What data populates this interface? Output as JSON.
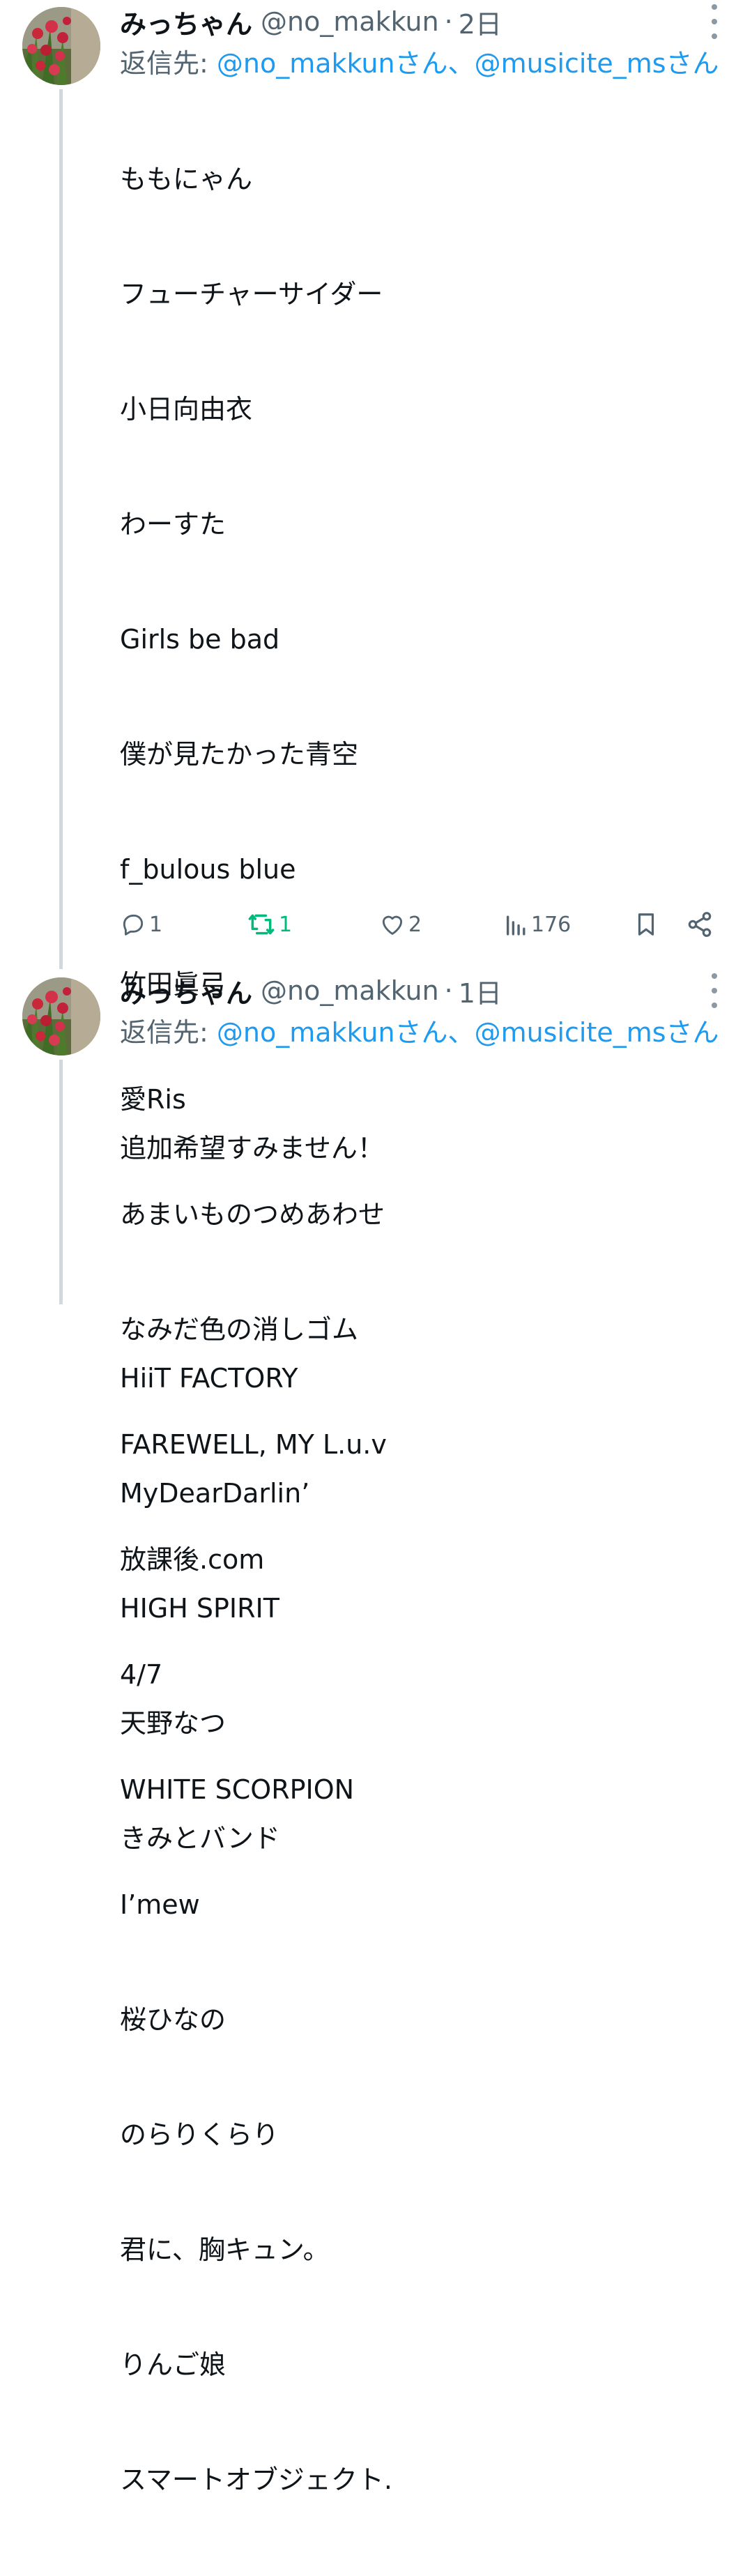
{
  "tweets": [
    {
      "display_name": "みっちゃん",
      "handle": "@no_makkun",
      "separator": "·",
      "time": "2日",
      "reply_prefix": "返信先: ",
      "reply_mention_1": "@no_makkunさん",
      "reply_sep": "、",
      "reply_mention_2": "@musicite_msさん",
      "lines": [
        "ももにゃん",
        "フューチャーサイダー",
        "小日向由衣",
        "わーすた",
        "Girls be bad",
        "僕が見たかった青空",
        "f_bulous blue",
        "竹田眞弓",
        "愛Ris",
        "あまいものつめあわせ",
        "なみだ色の消しゴム",
        "FAREWELL, MY L.u.v",
        "放課後.com",
        "4/7",
        "WHITE SCORPION",
        "I’mew",
        "桜ひなの",
        "のらりくらり",
        "君に、胸キュン。",
        "りんご娘",
        "スマートオブジェクト."
      ],
      "stats": {
        "replies": "1",
        "retweets": "1",
        "likes": "2",
        "views": "176"
      }
    },
    {
      "display_name": "みっちゃん",
      "handle": "@no_makkun",
      "separator": "·",
      "time": "1日",
      "reply_prefix": "返信先: ",
      "reply_mention_1": "@no_makkunさん",
      "reply_sep": "、",
      "reply_mention_2": "@musicite_msさん",
      "lines": [
        "追加希望すみません！",
        "",
        "HiiT FACTORY",
        "MyDearDarlin’",
        "HIGH SPIRIT",
        "天野なつ",
        "きみとバンド"
      ]
    }
  ],
  "icons": {
    "reply": "reply-icon",
    "retweet": "retweet-icon",
    "like": "heart-icon",
    "views": "views-icon",
    "bookmark": "bookmark-icon",
    "share": "share-icon",
    "more": "more-vertical-icon"
  },
  "colors": {
    "mention": "#1d9bf0",
    "retweet_active": "#00ba7c",
    "secondary_text": "#536471",
    "thread_line": "#cfd9de"
  }
}
